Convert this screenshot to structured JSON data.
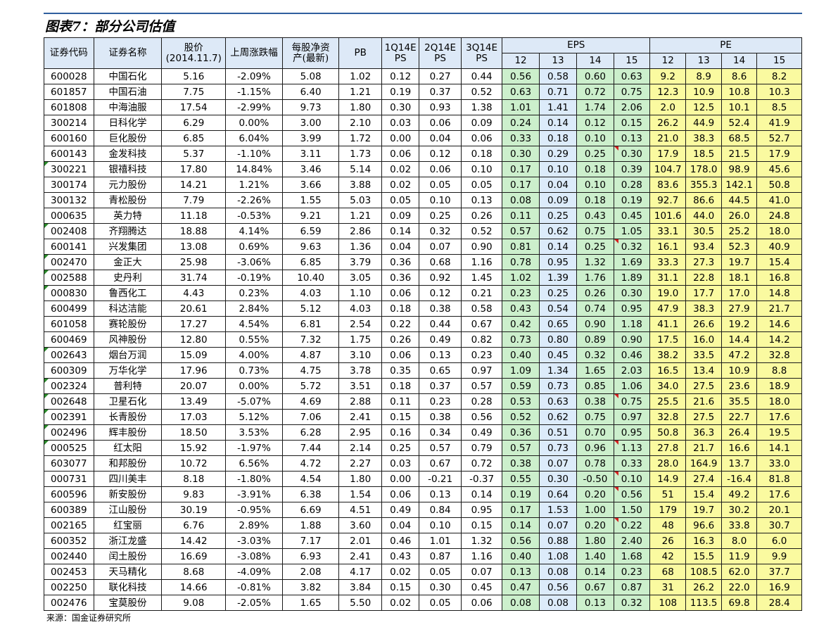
{
  "title": "图表7：部分公司估值",
  "footer": "来源：国金证券研究所",
  "colors": {
    "header_bg": "#dde9f7",
    "eps_bg": "#ccefcc",
    "eps_highlight_bg": "#dcebfa",
    "pe_bg": "#fafaa0",
    "rule": "#2f5f9e"
  },
  "headers": {
    "code": "证券代码",
    "name": "证券名称",
    "price_line1": "股价",
    "price_line2": "(2014.11.7)",
    "weekly": "上周涨跌幅",
    "bvps_line1": "每股净资",
    "bvps_line2": "产(最新)",
    "pb": "PB",
    "q1_line1": "1Q14E",
    "q1_line2": "PS",
    "q2_line1": "2Q14E",
    "q2_line2": "PS",
    "q3_line1": "3Q14E",
    "q3_line2": "PS",
    "eps": "EPS",
    "pe": "PE",
    "eps_years": [
      "12",
      "13",
      "14",
      "15"
    ],
    "pe_years": [
      "12",
      "13",
      "14",
      "15"
    ]
  },
  "rows": [
    {
      "code": "600028",
      "name": "中国石化",
      "price": "5.16",
      "weekly": "-2.09%",
      "bvps": "5.08",
      "pb": "1.02",
      "q1": "0.12",
      "q2": "0.27",
      "q3": "0.44",
      "eps": [
        "0.56",
        "0.58",
        "0.60",
        "0.63"
      ],
      "pe": [
        "9.2",
        "8.9",
        "8.6",
        "8.2"
      ]
    },
    {
      "code": "601857",
      "name": "中国石油",
      "price": "7.75",
      "weekly": "-1.15%",
      "bvps": "6.40",
      "pb": "1.21",
      "q1": "0.19",
      "q2": "0.37",
      "q3": "0.52",
      "eps": [
        "0.63",
        "0.71",
        "0.72",
        "0.75"
      ],
      "pe": [
        "12.3",
        "10.9",
        "10.8",
        "10.3"
      ]
    },
    {
      "code": "601808",
      "name": "中海油服",
      "price": "17.54",
      "weekly": "-2.99%",
      "bvps": "9.73",
      "pb": "1.80",
      "q1": "0.30",
      "q2": "0.93",
      "q3": "1.38",
      "eps": [
        "1.01",
        "1.41",
        "1.74",
        "2.06"
      ],
      "pe": [
        "2.0",
        "12.5",
        "10.1",
        "8.5"
      ]
    },
    {
      "code": "300214",
      "name": "日科化学",
      "price": "6.29",
      "weekly": "0.00%",
      "bvps": "3.00",
      "pb": "2.10",
      "q1": "0.03",
      "q2": "0.06",
      "q3": "0.09",
      "eps": [
        "0.24",
        "0.14",
        "0.12",
        "0.15"
      ],
      "pe": [
        "26.2",
        "44.9",
        "52.4",
        "41.9"
      ]
    },
    {
      "code": "600160",
      "name": "巨化股份",
      "price": "6.85",
      "weekly": "6.04%",
      "bvps": "3.99",
      "pb": "1.72",
      "q1": "0.00",
      "q2": "0.04",
      "q3": "0.06",
      "eps": [
        "0.33",
        "0.18",
        "0.10",
        "0.13"
      ],
      "pe": [
        "21.0",
        "38.3",
        "68.5",
        "52.7"
      ]
    },
    {
      "code": "600143",
      "name": "金发科技",
      "price": "5.37",
      "weekly": "-1.10%",
      "bvps": "3.11",
      "pb": "1.73",
      "q1": "0.06",
      "q2": "0.12",
      "q3": "0.18",
      "eps": [
        "0.30",
        "0.29",
        "0.25",
        "0.30"
      ],
      "pe": [
        "17.9",
        "18.5",
        "21.5",
        "17.9"
      ]
    },
    {
      "code": "300221",
      "name": "银禧科技",
      "price": "17.80",
      "weekly": "14.84%",
      "bvps": "3.46",
      "pb": "5.14",
      "q1": "0.02",
      "q2": "0.06",
      "q3": "0.10",
      "eps": [
        "0.17",
        "0.10",
        "0.18",
        "0.39"
      ],
      "pe": [
        "104.7",
        "178.0",
        "98.9",
        "45.6"
      ]
    },
    {
      "code": "300174",
      "name": "元力股份",
      "price": "14.21",
      "weekly": "1.21%",
      "bvps": "3.66",
      "pb": "3.88",
      "q1": "0.02",
      "q2": "0.05",
      "q3": "0.05",
      "eps": [
        "0.17",
        "0.04",
        "0.10",
        "0.28"
      ],
      "pe": [
        "83.6",
        "355.3",
        "142.1",
        "50.8"
      ]
    },
    {
      "code": "300132",
      "name": "青松股份",
      "price": "7.79",
      "weekly": "-2.26%",
      "bvps": "1.55",
      "pb": "5.03",
      "q1": "0.05",
      "q2": "0.10",
      "q3": "0.13",
      "eps": [
        "0.08",
        "0.09",
        "0.18",
        "0.19"
      ],
      "pe": [
        "92.7",
        "86.6",
        "44.5",
        "41.0"
      ]
    },
    {
      "code": "000635",
      "name": "英力特",
      "price": "11.18",
      "weekly": "-0.53%",
      "bvps": "9.21",
      "pb": "1.21",
      "q1": "0.09",
      "q2": "0.25",
      "q3": "0.26",
      "eps": [
        "0.11",
        "0.25",
        "0.43",
        "0.45"
      ],
      "pe": [
        "101.6",
        "44.0",
        "26.0",
        "24.8"
      ]
    },
    {
      "code": "002408",
      "name": "齐翔腾达",
      "price": "18.88",
      "weekly": "4.14%",
      "bvps": "6.59",
      "pb": "2.86",
      "q1": "0.14",
      "q2": "0.32",
      "q3": "0.52",
      "eps": [
        "0.57",
        "0.62",
        "0.75",
        "1.05"
      ],
      "pe": [
        "33.1",
        "30.5",
        "25.2",
        "18.0"
      ]
    },
    {
      "code": "600141",
      "name": "兴发集团",
      "price": "13.08",
      "weekly": "0.69%",
      "bvps": "9.63",
      "pb": "1.36",
      "q1": "0.04",
      "q2": "0.07",
      "q3": "0.90",
      "eps": [
        "0.81",
        "0.14",
        "0.25",
        "0.32"
      ],
      "pe": [
        "16.1",
        "93.4",
        "52.3",
        "40.9"
      ]
    },
    {
      "code": "002470",
      "name": "金正大",
      "price": "25.98",
      "weekly": "-3.06%",
      "bvps": "6.85",
      "pb": "3.79",
      "q1": "0.36",
      "q2": "0.68",
      "q3": "1.16",
      "eps": [
        "0.78",
        "0.95",
        "1.32",
        "1.69"
      ],
      "pe": [
        "33.3",
        "27.3",
        "19.7",
        "15.4"
      ]
    },
    {
      "code": "002588",
      "name": "史丹利",
      "price": "31.74",
      "weekly": "-0.19%",
      "bvps": "10.40",
      "pb": "3.05",
      "q1": "0.36",
      "q2": "0.92",
      "q3": "1.45",
      "eps": [
        "1.02",
        "1.39",
        "1.76",
        "1.89"
      ],
      "pe": [
        "31.1",
        "22.8",
        "18.1",
        "16.8"
      ]
    },
    {
      "code": "000830",
      "name": "鲁西化工",
      "price": "4.43",
      "weekly": "0.23%",
      "bvps": "4.03",
      "pb": "1.10",
      "q1": "0.06",
      "q2": "0.12",
      "q3": "0.21",
      "eps": [
        "0.23",
        "0.25",
        "0.26",
        "0.30"
      ],
      "pe": [
        "19.0",
        "17.7",
        "17.0",
        "14.8"
      ]
    },
    {
      "code": "600499",
      "name": "科达洁能",
      "price": "20.61",
      "weekly": "2.84%",
      "bvps": "5.12",
      "pb": "4.03",
      "q1": "0.18",
      "q2": "0.38",
      "q3": "0.58",
      "eps": [
        "0.43",
        "0.54",
        "0.74",
        "0.95"
      ],
      "pe": [
        "47.9",
        "38.3",
        "27.9",
        "21.7"
      ]
    },
    {
      "code": "601058",
      "name": "赛轮股份",
      "price": "17.27",
      "weekly": "4.54%",
      "bvps": "6.81",
      "pb": "2.54",
      "q1": "0.22",
      "q2": "0.44",
      "q3": "0.67",
      "eps": [
        "0.42",
        "0.65",
        "0.90",
        "1.18"
      ],
      "pe": [
        "41.1",
        "26.6",
        "19.2",
        "14.6"
      ]
    },
    {
      "code": "600469",
      "name": "风神股份",
      "price": "12.80",
      "weekly": "0.55%",
      "bvps": "7.32",
      "pb": "1.75",
      "q1": "0.26",
      "q2": "0.49",
      "q3": "0.82",
      "eps": [
        "0.73",
        "0.80",
        "0.89",
        "0.90"
      ],
      "pe": [
        "17.5",
        "16.0",
        "14.4",
        "14.2"
      ]
    },
    {
      "code": "002643",
      "name": "烟台万润",
      "price": "15.09",
      "weekly": "4.00%",
      "bvps": "4.87",
      "pb": "3.10",
      "q1": "0.06",
      "q2": "0.13",
      "q3": "0.23",
      "eps": [
        "0.40",
        "0.45",
        "0.32",
        "0.46"
      ],
      "pe": [
        "38.2",
        "33.5",
        "47.2",
        "32.8"
      ]
    },
    {
      "code": "600309",
      "name": "万华化学",
      "price": "17.96",
      "weekly": "0.73%",
      "bvps": "4.75",
      "pb": "3.78",
      "q1": "0.35",
      "q2": "0.65",
      "q3": "0.97",
      "eps": [
        "1.09",
        "1.34",
        "1.65",
        "2.03"
      ],
      "pe": [
        "16.5",
        "13.4",
        "10.9",
        "8.8"
      ]
    },
    {
      "code": "002324",
      "name": "普利特",
      "price": "20.07",
      "weekly": "0.00%",
      "bvps": "5.72",
      "pb": "3.51",
      "q1": "0.18",
      "q2": "0.37",
      "q3": "0.57",
      "eps": [
        "0.59",
        "0.73",
        "0.85",
        "1.06"
      ],
      "pe": [
        "34.0",
        "27.5",
        "23.6",
        "18.9"
      ]
    },
    {
      "code": "002648",
      "name": "卫星石化",
      "price": "13.49",
      "weekly": "-5.07%",
      "bvps": "4.69",
      "pb": "2.88",
      "q1": "0.11",
      "q2": "0.23",
      "q3": "0.28",
      "eps": [
        "0.53",
        "0.63",
        "0.38",
        "0.75"
      ],
      "pe": [
        "25.5",
        "21.6",
        "35.5",
        "18.0"
      ]
    },
    {
      "code": "002391",
      "name": "长青股份",
      "price": "17.03",
      "weekly": "5.12%",
      "bvps": "7.06",
      "pb": "2.41",
      "q1": "0.15",
      "q2": "0.38",
      "q3": "0.56",
      "eps": [
        "0.52",
        "0.62",
        "0.75",
        "0.97"
      ],
      "pe": [
        "32.8",
        "27.5",
        "22.7",
        "17.6"
      ]
    },
    {
      "code": "002496",
      "name": "辉丰股份",
      "price": "18.50",
      "weekly": "3.53%",
      "bvps": "6.28",
      "pb": "2.95",
      "q1": "0.16",
      "q2": "0.34",
      "q3": "0.49",
      "eps": [
        "0.36",
        "0.51",
        "0.70",
        "0.95"
      ],
      "pe": [
        "50.8",
        "36.3",
        "26.4",
        "19.5"
      ]
    },
    {
      "code": "000525",
      "name": "红太阳",
      "price": "15.92",
      "weekly": "-1.97%",
      "bvps": "7.44",
      "pb": "2.14",
      "q1": "0.25",
      "q2": "0.57",
      "q3": "0.79",
      "eps": [
        "0.57",
        "0.73",
        "0.96",
        "1.13"
      ],
      "pe": [
        "27.8",
        "21.7",
        "16.6",
        "14.1"
      ]
    },
    {
      "code": "603077",
      "name": "和邦股份",
      "price": "10.72",
      "weekly": "6.56%",
      "bvps": "4.72",
      "pb": "2.27",
      "q1": "0.03",
      "q2": "0.67",
      "q3": "0.72",
      "eps": [
        "0.38",
        "0.07",
        "0.78",
        "0.33"
      ],
      "pe": [
        "28.0",
        "164.9",
        "13.7",
        "33.0"
      ]
    },
    {
      "code": "000731",
      "name": "四川美丰",
      "price": "8.18",
      "weekly": "-1.80%",
      "bvps": "4.54",
      "pb": "1.80",
      "q1": "0.00",
      "q2": "-0.21",
      "q3": "-0.37",
      "eps": [
        "0.55",
        "0.30",
        "-0.50",
        "0.10"
      ],
      "pe": [
        "14.9",
        "27.4",
        "-16.4",
        "81.8"
      ]
    },
    {
      "code": "600596",
      "name": "新安股份",
      "price": "9.83",
      "weekly": "-3.91%",
      "bvps": "6.38",
      "pb": "1.54",
      "q1": "0.06",
      "q2": "0.13",
      "q3": "0.14",
      "eps": [
        "0.19",
        "0.64",
        "0.20",
        "0.56"
      ],
      "pe": [
        "51",
        "15.4",
        "49.2",
        "17.6"
      ]
    },
    {
      "code": "600389",
      "name": "江山股份",
      "price": "30.19",
      "weekly": "-0.95%",
      "bvps": "6.69",
      "pb": "4.51",
      "q1": "0.49",
      "q2": "0.84",
      "q3": "0.95",
      "eps": [
        "0.17",
        "1.53",
        "1.00",
        "1.50"
      ],
      "pe": [
        "179",
        "19.7",
        "30.2",
        "20.1"
      ]
    },
    {
      "code": "002165",
      "name": "红宝丽",
      "price": "6.76",
      "weekly": "2.89%",
      "bvps": "1.88",
      "pb": "3.60",
      "q1": "0.04",
      "q2": "0.10",
      "q3": "0.15",
      "eps": [
        "0.14",
        "0.07",
        "0.20",
        "0.22"
      ],
      "pe": [
        "48",
        "96.6",
        "33.8",
        "30.7"
      ]
    },
    {
      "code": "600352",
      "name": "浙江龙盛",
      "price": "14.42",
      "weekly": "-3.03%",
      "bvps": "7.17",
      "pb": "2.01",
      "q1": "0.46",
      "q2": "1.01",
      "q3": "1.32",
      "eps": [
        "0.56",
        "0.88",
        "1.80",
        "2.40"
      ],
      "pe": [
        "26",
        "16.3",
        "8.0",
        "6.0"
      ]
    },
    {
      "code": "002440",
      "name": "闰土股份",
      "price": "16.69",
      "weekly": "-3.08%",
      "bvps": "6.93",
      "pb": "2.41",
      "q1": "0.43",
      "q2": "0.87",
      "q3": "1.16",
      "eps": [
        "0.40",
        "1.08",
        "1.40",
        "1.68"
      ],
      "pe": [
        "42",
        "15.5",
        "11.9",
        "9.9"
      ]
    },
    {
      "code": "002453",
      "name": "天马精化",
      "price": "8.68",
      "weekly": "-4.09%",
      "bvps": "2.08",
      "pb": "4.17",
      "q1": "0.02",
      "q2": "0.05",
      "q3": "0.07",
      "eps": [
        "0.13",
        "0.08",
        "0.14",
        "0.23"
      ],
      "pe": [
        "68",
        "108.5",
        "62.0",
        "37.7"
      ]
    },
    {
      "code": "002250",
      "name": "联化科技",
      "price": "14.66",
      "weekly": "-0.81%",
      "bvps": "3.82",
      "pb": "3.84",
      "q1": "0.15",
      "q2": "0.30",
      "q3": "0.45",
      "eps": [
        "0.47",
        "0.56",
        "0.67",
        "0.87"
      ],
      "pe": [
        "31",
        "26.2",
        "22.0",
        "16.9"
      ]
    },
    {
      "code": "002476",
      "name": "宝莫股份",
      "price": "9.08",
      "weekly": "-2.05%",
      "bvps": "1.65",
      "pb": "5.50",
      "q1": "0.02",
      "q2": "0.05",
      "q3": "0.06",
      "eps": [
        "0.08",
        "0.08",
        "0.13",
        "0.32"
      ],
      "pe": [
        "108",
        "113.5",
        "69.8",
        "28.4"
      ]
    }
  ]
}
